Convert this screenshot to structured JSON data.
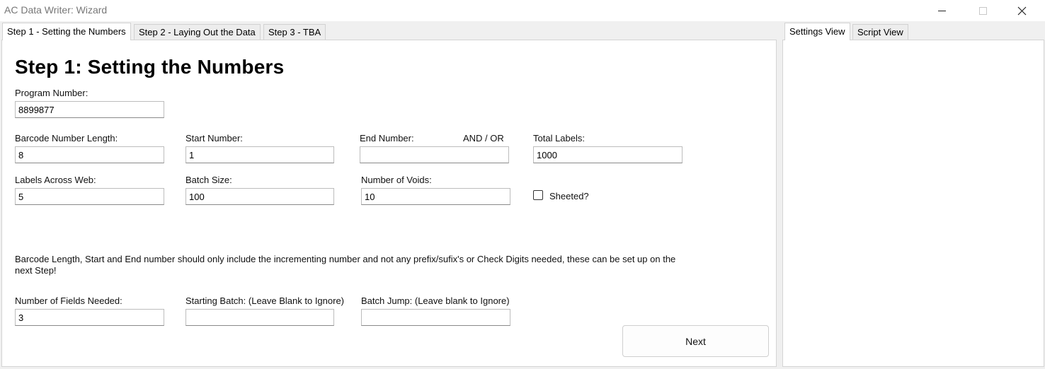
{
  "window": {
    "title": "AC Data Writer: Wizard"
  },
  "tabs_left": [
    "Step 1 - Setting the Numbers",
    "Step 2 - Laying Out the Data",
    "Step 3 - TBA"
  ],
  "tabs_right": [
    "Settings View",
    "Script View"
  ],
  "step1": {
    "heading": "Step 1: Setting the Numbers",
    "program_number": {
      "label": "Program Number:",
      "value": "8899877"
    },
    "barcode_length": {
      "label": "Barcode Number Length:",
      "value": "8"
    },
    "start_number": {
      "label": "Start Number:",
      "value": "1"
    },
    "end_number": {
      "label": "End Number:",
      "value": ""
    },
    "and_or": "AND / OR",
    "total_labels": {
      "label": "Total Labels:",
      "value": "1000"
    },
    "labels_across": {
      "label": "Labels Across Web:",
      "value": "5"
    },
    "batch_size": {
      "label": "Batch Size:",
      "value": "100"
    },
    "number_of_voids": {
      "label": "Number of Voids:",
      "value": "10"
    },
    "sheeted": {
      "label": "Sheeted?",
      "checked": false
    },
    "note": "Barcode Length, Start and End number should only include the incrementing number and not any prefix/sufix's or Check Digits needed, these can be set up on the next Step!",
    "fields_needed": {
      "label": "Number of Fields Needed:",
      "value": "3"
    },
    "starting_batch": {
      "label": "Starting Batch: (Leave Blank to Ignore)",
      "value": ""
    },
    "batch_jump": {
      "label": "Batch Jump: (Leave blank to Ignore)",
      "value": ""
    },
    "next_label": "Next"
  }
}
